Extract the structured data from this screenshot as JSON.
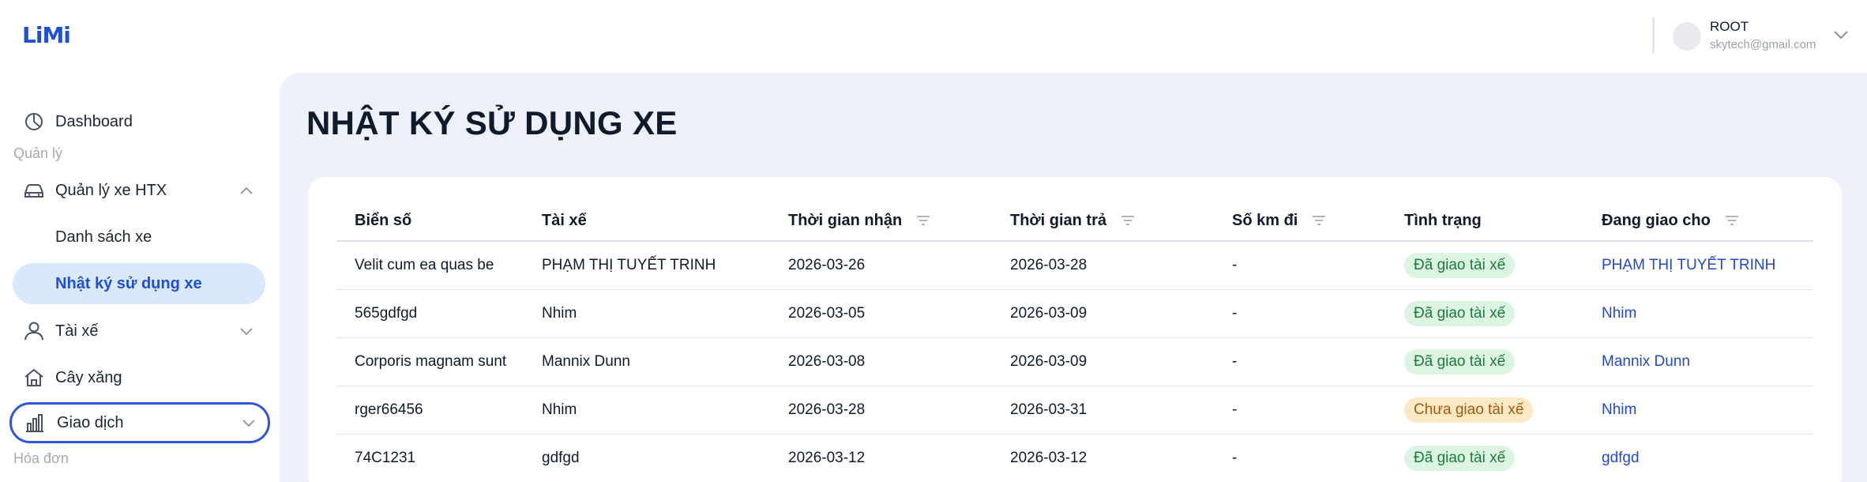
{
  "app": {
    "logo": "LiMi",
    "brand_color": "#1f4fd8",
    "accent_bg": "#d9e8fb"
  },
  "user": {
    "name": "ROOT",
    "email": "skytech@gmail.com"
  },
  "sidebar": {
    "dashboard": "Dashboard",
    "section_quan_ly": "Quản lý",
    "quan_ly_xe": "Quản lý xe HTX",
    "danh_sach_xe": "Danh sách xe",
    "nhat_ky": "Nhật ký sử dụng xe",
    "tai_xe": "Tài xế",
    "cay_xang": "Cây xăng",
    "giao_dich": "Giao dịch",
    "section_hoa_don": "Hóa đơn"
  },
  "page": {
    "title": "NHẬT KÝ SỬ DỤNG XE"
  },
  "table": {
    "headers": [
      "Biển số",
      "Tài xế",
      "Thời gian nhận",
      "Thời gian trả",
      "Số km đi",
      "Tình trạng",
      "Đang giao cho"
    ],
    "rows": [
      {
        "plate": "Velit cum ea quas be",
        "driver": "PHẠM THỊ TUYẾT TRINH",
        "received": "2026-03-26",
        "returned": "2026-03-28",
        "km": "-",
        "status": "Đã giao tài xế",
        "status_color": "green",
        "assigned": "PHẠM THỊ TUYẾT TRINH"
      },
      {
        "plate": "565gdfgd",
        "driver": "Nhim",
        "received": "2026-03-05",
        "returned": "2026-03-09",
        "km": "-",
        "status": "Đã giao tài xế",
        "status_color": "green",
        "assigned": "Nhim"
      },
      {
        "plate": "Corporis magnam sunt",
        "driver": "Mannix Dunn",
        "received": "2026-03-08",
        "returned": "2026-03-09",
        "km": "-",
        "status": "Đã giao tài xế",
        "status_color": "green",
        "assigned": "Mannix Dunn"
      },
      {
        "plate": "rger66456",
        "driver": "Nhim",
        "received": "2026-03-28",
        "returned": "2026-03-31",
        "km": "-",
        "status": "Chưa giao tài xế",
        "status_color": "orange",
        "assigned": "Nhim"
      },
      {
        "plate": "74C1231",
        "driver": "gdfgd",
        "received": "2026-03-12",
        "returned": "2026-03-12",
        "km": "-",
        "status": "Đã giao tài xế",
        "status_color": "green",
        "assigned": "gdfgd"
      }
    ]
  }
}
